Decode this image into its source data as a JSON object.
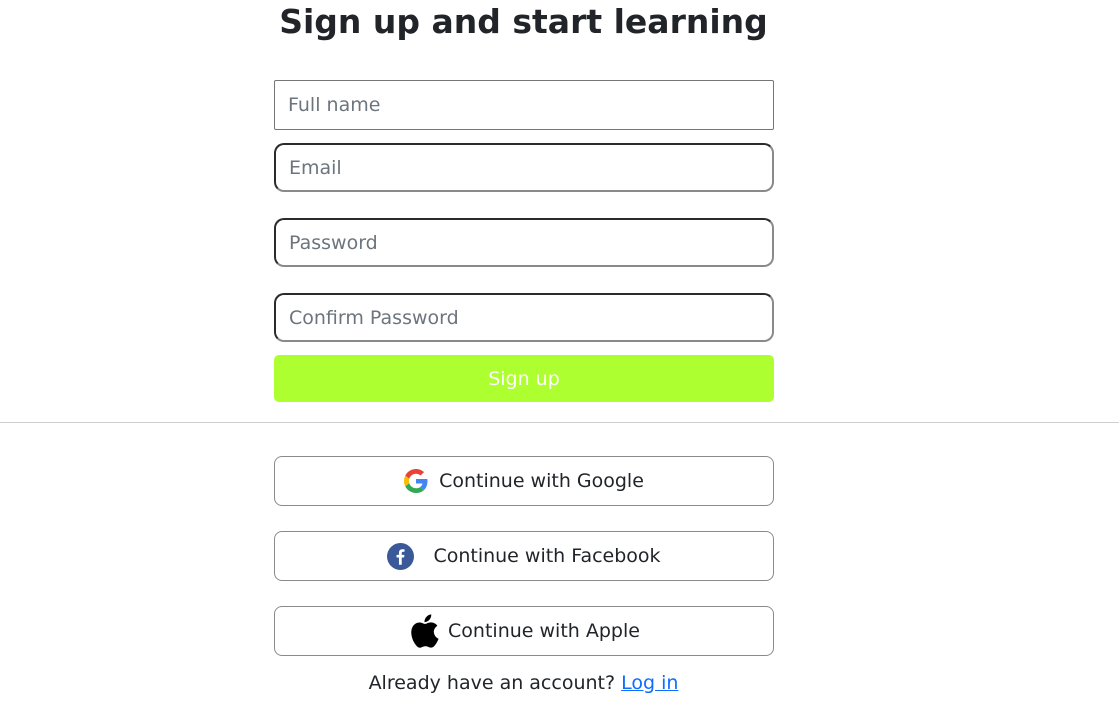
{
  "page": {
    "title": "Sign up and start learning"
  },
  "form": {
    "full_name_placeholder": "Full name",
    "email_placeholder": "Email",
    "password_placeholder": "Password",
    "confirm_password_placeholder": "Confirm Password",
    "signup_label": "Sign up"
  },
  "social": {
    "google_label": "Continue with Google",
    "facebook_label": "Continue with Facebook",
    "apple_label": "Continue with Apple"
  },
  "footer": {
    "prompt": "Already have an account?",
    "login_label": "Log in"
  },
  "colors": {
    "signup_button": "#adff2f",
    "link": "#0d6efd",
    "facebook": "#3b5998"
  },
  "icons": {
    "google": "google-icon",
    "facebook": "facebook-icon",
    "apple": "apple-icon"
  }
}
